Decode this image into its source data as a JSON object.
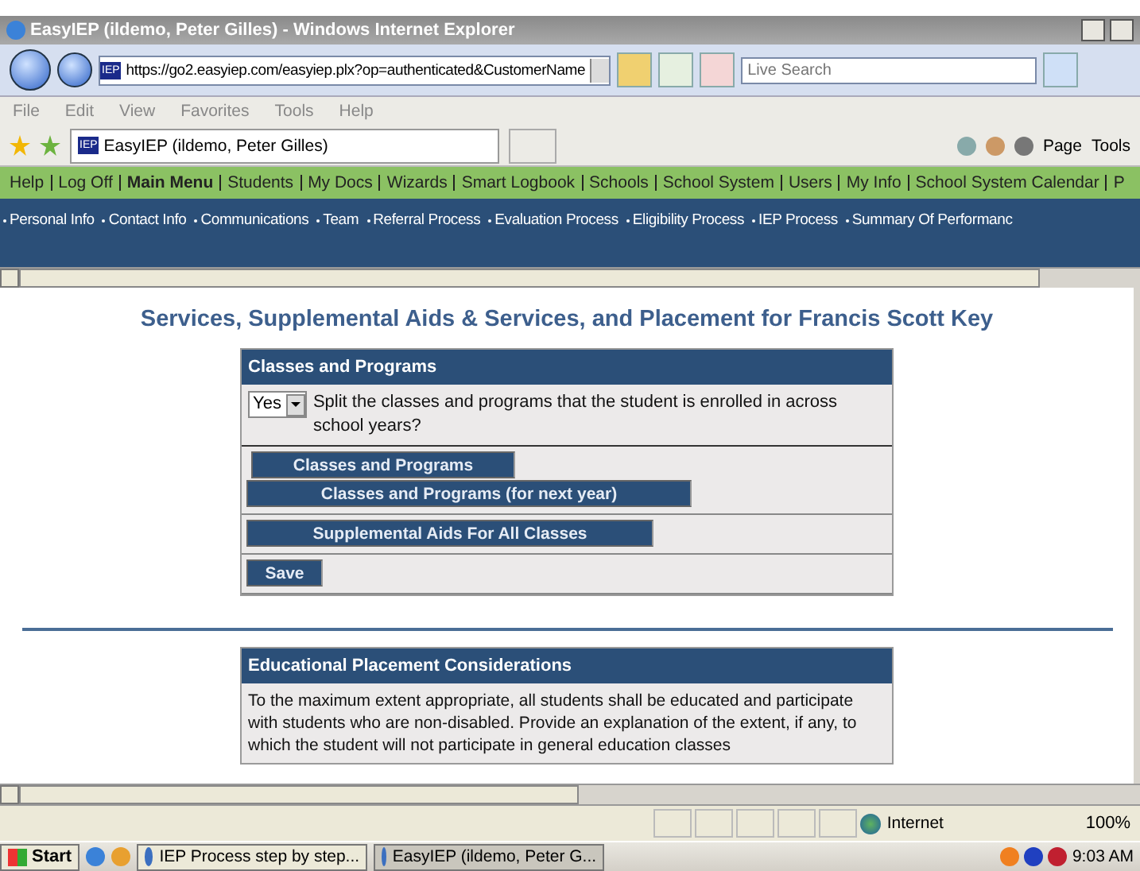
{
  "window": {
    "title": "EasyIEP (ildemo, Peter Gilles) - Windows Internet Explorer"
  },
  "address_bar": {
    "site_icon": "IEP",
    "url": "https://go2.easyiep.com/easyiep.plx?op=authenticated&CustomerName",
    "search_placeholder": "Live Search"
  },
  "menu": [
    "File",
    "Edit",
    "View",
    "Favorites",
    "Tools",
    "Help"
  ],
  "tab": {
    "icon": "IEP",
    "title": "EasyIEP (ildemo, Peter Gilles)"
  },
  "command_bar": [
    "Page",
    "Tools"
  ],
  "main_nav": [
    {
      "label": "Help",
      "selected": false
    },
    {
      "label": "Log Off",
      "selected": false
    },
    {
      "label": "Main Menu",
      "selected": true
    },
    {
      "label": "Students",
      "selected": false
    },
    {
      "label": "My Docs",
      "selected": false
    },
    {
      "label": "Wizards",
      "selected": false
    },
    {
      "label": "Smart Logbook",
      "selected": false
    },
    {
      "label": "Schools",
      "selected": false
    },
    {
      "label": "School System",
      "selected": false
    },
    {
      "label": "Users",
      "selected": false
    },
    {
      "label": "My Info",
      "selected": false
    },
    {
      "label": "School System Calendar",
      "selected": false
    },
    {
      "label": "P",
      "selected": false
    }
  ],
  "sub_nav": [
    "Personal Info",
    "Contact Info",
    "Communications",
    "Team",
    "Referral Process",
    "Evaluation Process",
    "Eligibility Process",
    "IEP Process",
    "Summary Of Performanc"
  ],
  "page": {
    "heading": "Services, Supplemental Aids & Services, and Placement for Francis Scott Key"
  },
  "classes_panel": {
    "header": "Classes and Programs",
    "select_value": "Yes",
    "question": "Split the classes and programs that the student is enrolled in across school years?",
    "button_groups": [
      [
        "Classes and Programs",
        "Classes and Programs (for next year)"
      ],
      [
        "Supplemental Aids For All Classes"
      ]
    ],
    "save": "Save"
  },
  "placement_panel": {
    "header": "Educational Placement Considerations",
    "text": "To the maximum extent appropriate, all students shall be educated and participate with students who are non-disabled. Provide an explanation of the extent, if any, to which the student will not participate in general education classes"
  },
  "status_bar": {
    "zone": "Internet",
    "zoom": "100%"
  },
  "taskbar": {
    "start": "Start",
    "windows": [
      {
        "label": "IEP Process step by step...",
        "selected": false
      },
      {
        "label": "EasyIEP (ildemo, Peter G...",
        "selected": true
      }
    ],
    "clock": "9:03 AM"
  }
}
